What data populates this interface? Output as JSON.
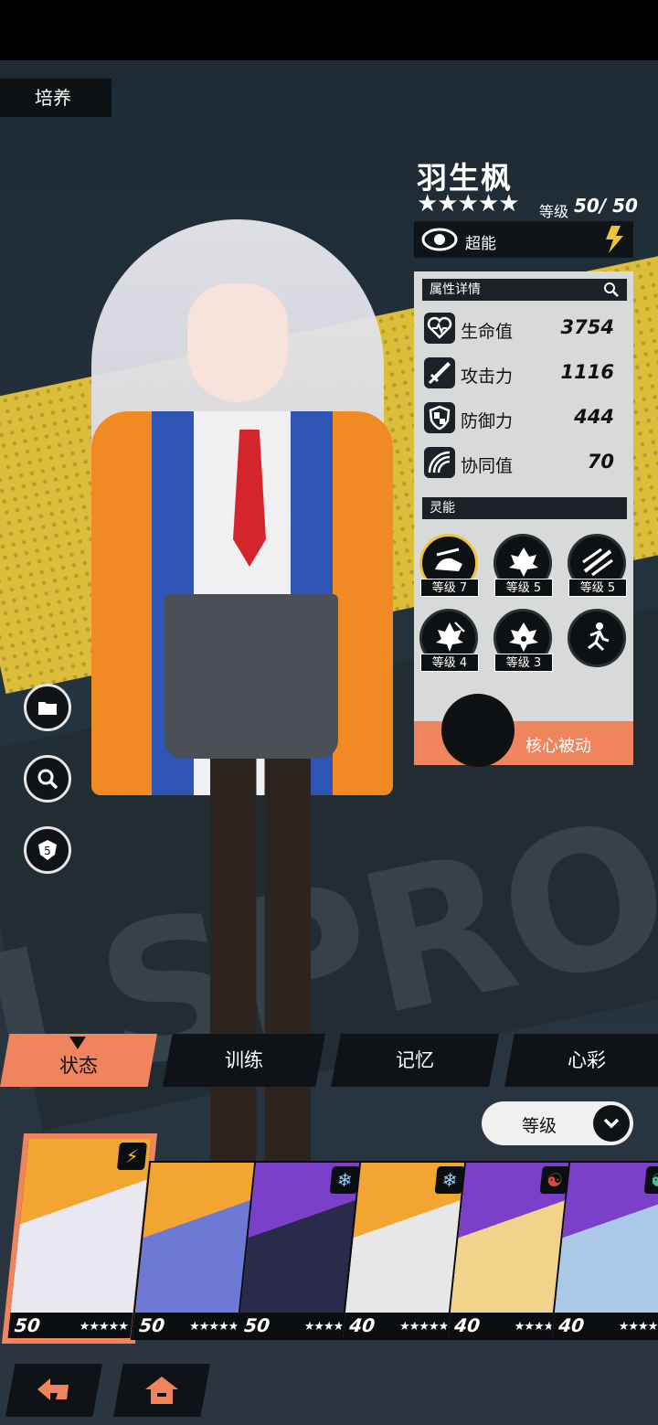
{
  "header": {
    "tag": "培养"
  },
  "character": {
    "name": "羽生枫",
    "stars": "★★★★★",
    "level_label": "等级",
    "level_value": "50/ 50",
    "type_label": "超能"
  },
  "attributes": {
    "header": "属性详情",
    "stats": [
      {
        "name": "生命值",
        "value": "3754",
        "icon": "heart-pulse-icon"
      },
      {
        "name": "攻击力",
        "value": "1116",
        "icon": "sword-icon"
      },
      {
        "name": "防御力",
        "value": "444",
        "icon": "shield-icon"
      },
      {
        "name": "协同值",
        "value": "70",
        "icon": "wave-arcs-icon"
      }
    ],
    "skills_header": "灵能",
    "skills": [
      {
        "level": "等级 7",
        "icon": "shoe-skill-icon"
      },
      {
        "level": "等级 5",
        "icon": "leaf-skill-icon"
      },
      {
        "level": "等级 5",
        "icon": "slash-skill-icon"
      },
      {
        "level": "等级 4",
        "icon": "leaf-burst-skill-icon"
      },
      {
        "level": "等级 3",
        "icon": "leaf-dots-skill-icon"
      },
      {
        "level": "",
        "icon": "runner-skill-icon"
      }
    ],
    "core_label": "核心被动"
  },
  "side_buttons": [
    "folder-icon",
    "search-icon",
    "shield-badge-icon"
  ],
  "side_badge": "5",
  "tabs": [
    "状态",
    "训练",
    "记忆",
    "心彩"
  ],
  "sort": {
    "label": "等级"
  },
  "bg_text": "LSPRO",
  "roster": [
    {
      "level": "50",
      "stars": "★★★★★",
      "elem": "⚡",
      "colors": [
        "#f3a531",
        "#e9e7ef"
      ]
    },
    {
      "level": "50",
      "stars": "★★★★★",
      "elem": "",
      "colors": [
        "#f3a531",
        "#6c7ad6"
      ]
    },
    {
      "level": "50",
      "stars": "★★★★",
      "elem": "❄",
      "colors": [
        "#7b3fc9",
        "#2a2a4a"
      ]
    },
    {
      "level": "40",
      "stars": "★★★★★",
      "elem": "❄",
      "colors": [
        "#f3a531",
        "#e7e7e7"
      ]
    },
    {
      "level": "40",
      "stars": "★★★★",
      "elem": "☯",
      "colors": [
        "#7b3fc9",
        "#f1d38c"
      ]
    },
    {
      "level": "40",
      "stars": "★★★★",
      "elem": "☯",
      "colors": [
        "#7b3fc9",
        "#a9c9e6"
      ]
    }
  ]
}
